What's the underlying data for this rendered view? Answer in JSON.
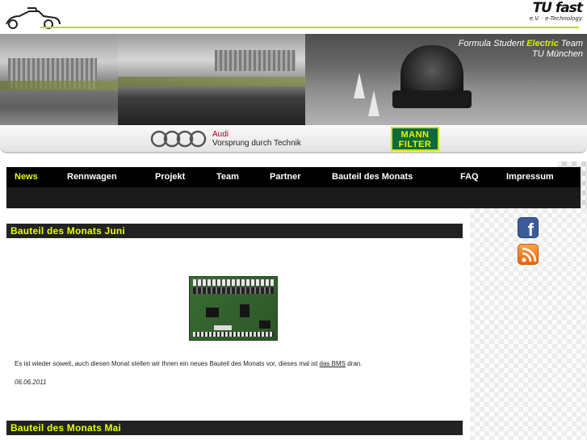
{
  "header": {
    "logo_text_big": "TU fast",
    "logo_ev": "e.V.",
    "logo_sub": "e-Technology"
  },
  "banner": {
    "title_pre": "Formula Student ",
    "title_highlight": "Electric",
    "title_post": " Team",
    "subtitle": "TU München"
  },
  "sponsors": {
    "audi_brand": "Audi",
    "audi_slogan": "Vorsprung durch Technik",
    "mann_line1": "MANN",
    "mann_line2": "FILTER"
  },
  "nav": {
    "items": [
      {
        "label": "News"
      },
      {
        "label": "Rennwagen"
      },
      {
        "label": "Projekt"
      },
      {
        "label": "Team"
      },
      {
        "label": "Partner"
      },
      {
        "label": "Bauteil des Monats"
      },
      {
        "label": "FAQ"
      },
      {
        "label": "Impressum"
      }
    ]
  },
  "social": {
    "facebook_glyph": "f",
    "facebook_icon": "facebook-icon",
    "rss_icon": "rss-icon"
  },
  "posts": [
    {
      "title": "Bauteil des Monats Juni",
      "text_before": "Es ist wieder soweit, auch diesen Monat stellen wir Ihnen ein neues Bauteil des Monats vor, dieses mal ist ",
      "link": "das BMS",
      "text_after": " dran.",
      "date": "06.06.2011"
    },
    {
      "title": "Bauteil des Monats Mai"
    }
  ],
  "colors": {
    "accent": "#e4ff00",
    "nav_bg": "#000000",
    "section_bar": "#222222"
  }
}
